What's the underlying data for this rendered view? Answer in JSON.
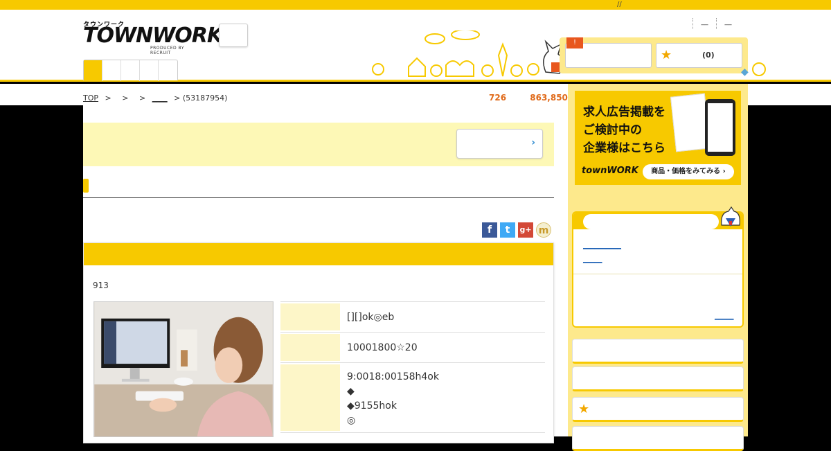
{
  "topbar": {
    "text": "//"
  },
  "header": {
    "logo_small": "タウンワーク",
    "logo_main": "TOWNWORK",
    "logo_sub": "PRODUCED BY RECRUIT",
    "top_links": [
      "__",
      "__"
    ],
    "badge": "!",
    "fav_count": "(0)"
  },
  "breadcrumb": {
    "top": "TOP",
    "sep": ">",
    "link_blank": "____",
    "job_id": "> (53187954)"
  },
  "counts": {
    "a": "726",
    "b": "863,850"
  },
  "social": {
    "fb": "f",
    "tw": "t",
    "gp": "g+",
    "mx": "m"
  },
  "job": {
    "number": "913",
    "rows": [
      {
        "value": "[][]ok◎eb"
      },
      {
        "value": "10001800☆20"
      },
      {
        "value_lines": [
          "9:0018:00158h4ok",
          "◆",
          "◆9155hok",
          "◎"
        ]
      }
    ]
  },
  "sidebar": {
    "ad_text_1": "求人広告掲載を",
    "ad_text_2": "ご検討中の",
    "ad_text_3": "企業様はこちら",
    "ad_logo": "townWORK",
    "ad_button": "商品・価格をみてみる ›",
    "recent_link_1": "__________",
    "recent_link_2": "_____",
    "recent_link_3": "_____"
  },
  "colors": {
    "brand_yellow": "#f7c900",
    "light_yellow": "#fde98c",
    "count_orange": "#e06a1a"
  }
}
